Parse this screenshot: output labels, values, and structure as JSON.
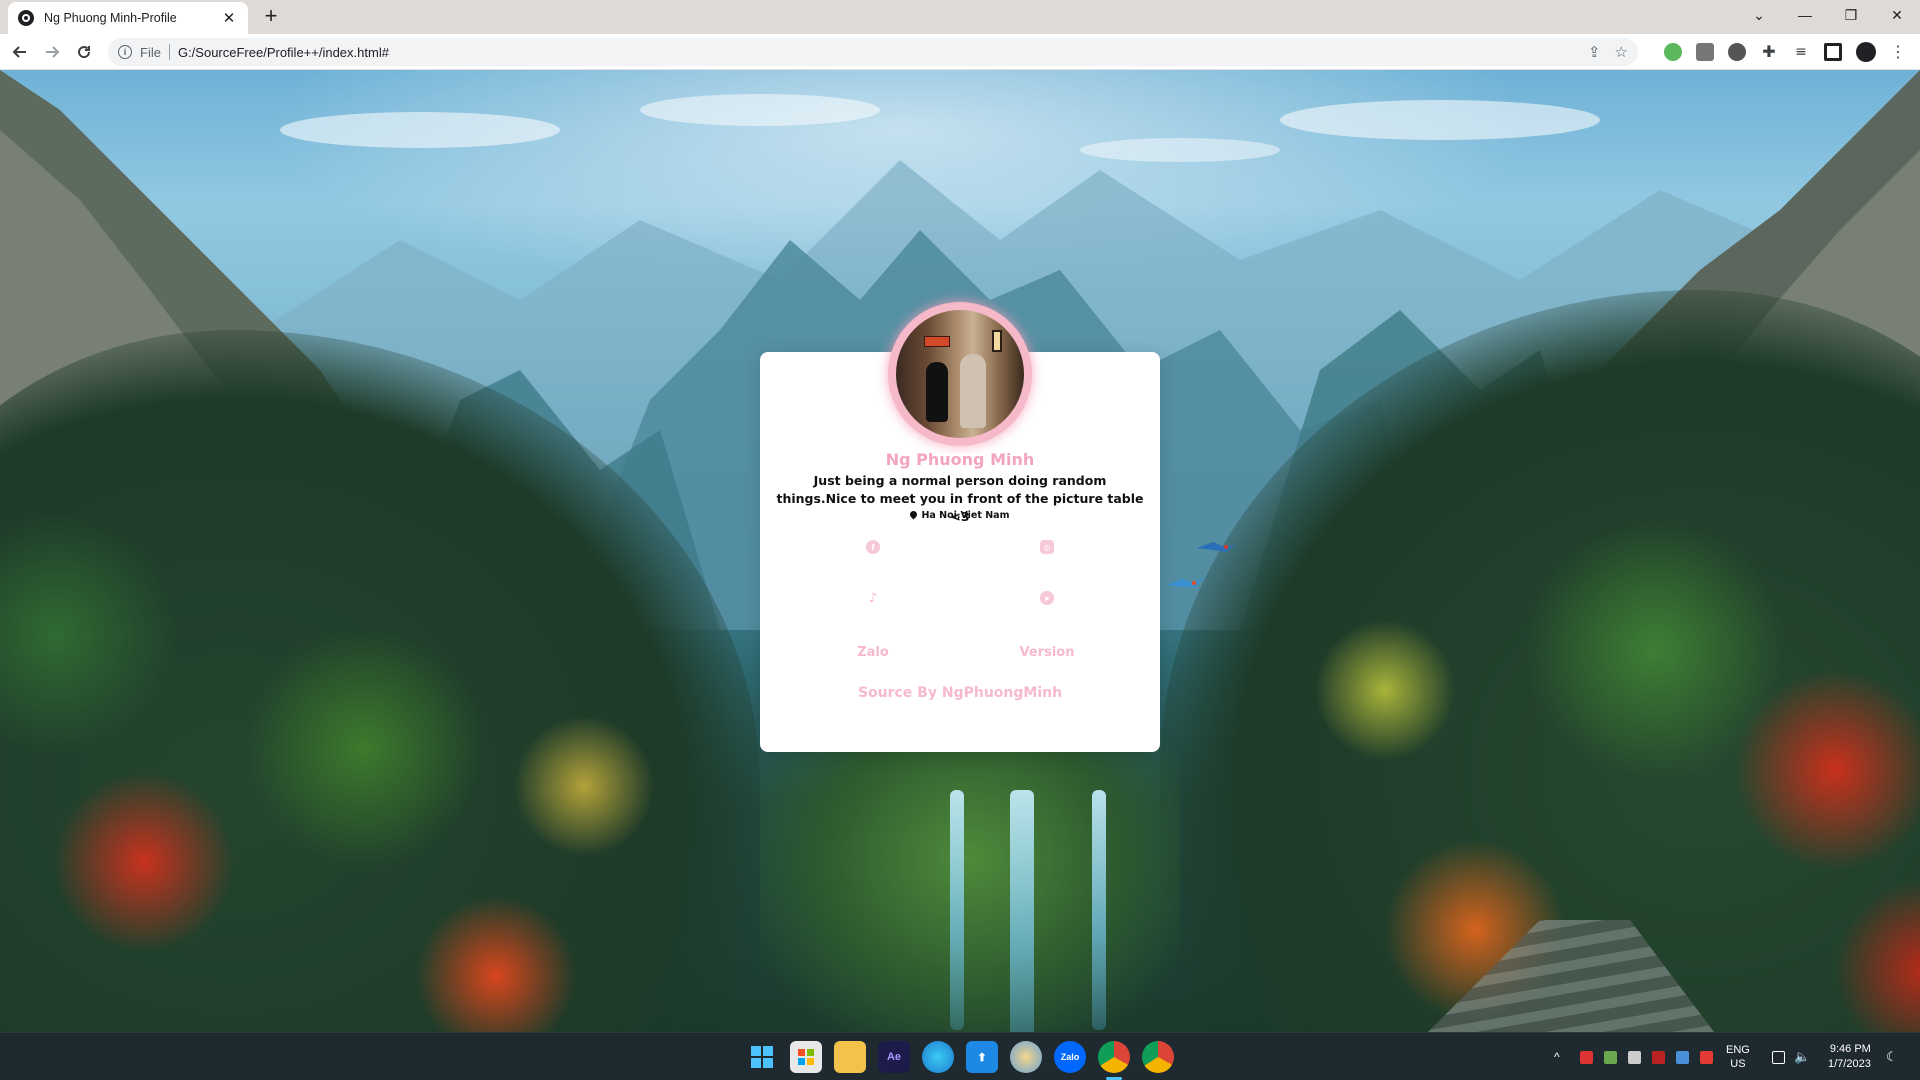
{
  "browser": {
    "tab_title": "Ng Phuong Minh-Profile",
    "tab_close": "✕",
    "new_tab": "+",
    "scheme": "File",
    "url": "G:/SourceFree/Profile++/index.html#",
    "window_controls": {
      "chevron": "⌄",
      "minimize": "—",
      "restore": "❐",
      "close": "✕"
    }
  },
  "profile": {
    "name": "Ng Phuong Minh",
    "bio": "Just being a normal person doing random things.Nice to meet you in front of the picture table <3",
    "location": "Ha Noi,Viet Nam",
    "social_icons": [
      "facebook-icon",
      "instagram-icon",
      "tiktok-icon",
      "telegram-icon"
    ],
    "links": {
      "zalo": "Zalo",
      "version": "Version",
      "source": "Source By NgPhuongMinh"
    },
    "colors": {
      "accent": "#f4a3c0",
      "link": "#f7b9cc",
      "card": "#ffffff"
    }
  },
  "taskbar": {
    "apps": [
      "windows-start",
      "microsoft-store",
      "file-explorer",
      "after-effects",
      "edge",
      "upload-app",
      "app-7",
      "zalo",
      "chrome",
      "chrome-profile"
    ],
    "ae_label": "Ae",
    "zalo_label": "Zalo",
    "language": "ENG",
    "region": "US",
    "time": "9:46 PM",
    "date": "1/7/2023"
  }
}
